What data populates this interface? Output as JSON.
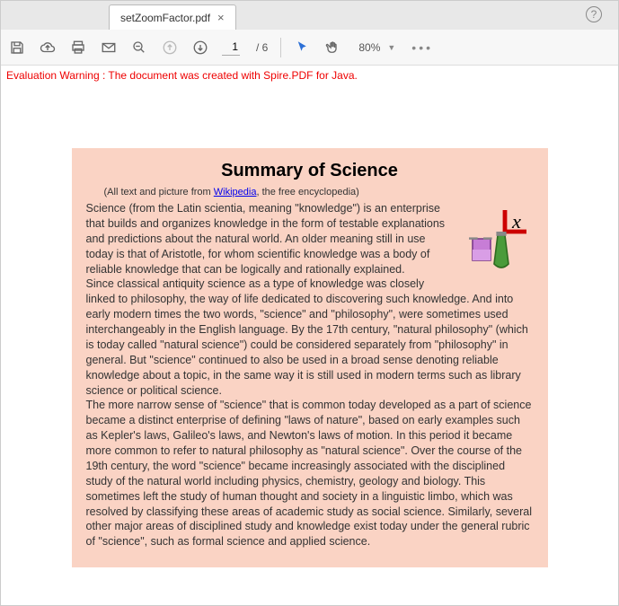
{
  "tab": {
    "title": "setZoomFactor.pdf"
  },
  "toolbar": {
    "page_current": "1",
    "page_total": "/ 6",
    "zoom": "80%"
  },
  "warning": "Evaluation Warning : The document was created with Spire.PDF for Java.",
  "doc": {
    "title": "Summary of Science",
    "sub_pre": "(All text and picture from ",
    "sub_link": "Wikipedia",
    "sub_post": ", the free encyclopedia)",
    "p1": "Science (from the Latin scientia, meaning \"knowledge\") is an enterprise that builds and organizes knowledge in the form of testable explanations and predictions about the natural world. An older meaning still in use today is that of Aristotle, for whom scientific knowledge was a body of reliable knowledge that can be logically and rationally explained.",
    "p2": "Since classical antiquity science as a type of knowledge was closely linked to philosophy, the way of life dedicated to discovering such knowledge. And into early modern times the two words, \"science\" and \"philosophy\", were sometimes used interchangeably in the English language. By the 17th century, \"natural philosophy\" (which is today called \"natural science\") could be considered separately from \"philosophy\" in general. But \"science\" continued to also be used in a broad sense denoting reliable knowledge about a topic, in the same way it is still used in modern terms such as library science or political science.",
    "p3": "The more narrow sense of \"science\" that is common today developed as a part of science became a distinct enterprise of defining \"laws of nature\", based on early examples such as Kepler's laws, Galileo's laws, and Newton's laws of motion. In this period it became more common to refer to natural philosophy as \"natural science\". Over the course of the 19th century, the word \"science\" became increasingly associated with the disciplined study of the natural world including physics, chemistry, geology and biology. This sometimes left the study of human thought and society in a linguistic limbo, which was resolved by classifying these areas of academic study as social science. Similarly, several other major areas of disciplined study and knowledge exist today under the general rubric of \"science\", such as formal science and applied science."
  }
}
